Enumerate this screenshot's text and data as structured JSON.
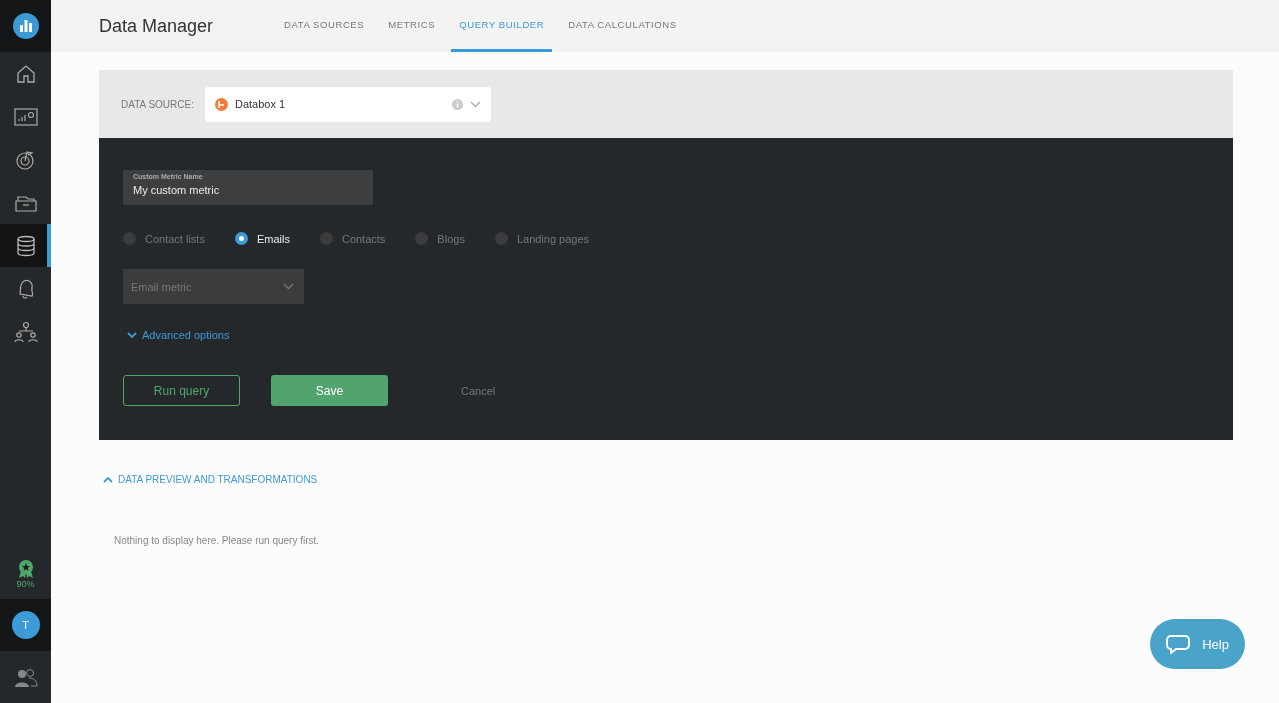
{
  "sidebar": {
    "items": [
      {
        "kind": "home",
        "selected": false
      },
      {
        "kind": "dashboard",
        "selected": false
      },
      {
        "kind": "goal",
        "selected": false
      },
      {
        "kind": "folder",
        "selected": false
      },
      {
        "kind": "database",
        "selected": true
      },
      {
        "kind": "bell",
        "selected": false
      },
      {
        "kind": "team",
        "selected": false
      }
    ],
    "badge": "90%",
    "avatar": "T"
  },
  "header": {
    "title": "Data Manager",
    "tabs": [
      {
        "label": "DATA SOURCES",
        "selected": false
      },
      {
        "label": "METRICS",
        "selected": false
      },
      {
        "label": "QUERY BUILDER",
        "selected": true
      },
      {
        "label": "DATA CALCULATIONS",
        "selected": false
      }
    ]
  },
  "data_source": {
    "label": "DATA SOURCE:",
    "value": "Databox 1"
  },
  "query": {
    "name_field": {
      "label": "Custom Metric Name",
      "value": "My custom metric"
    },
    "options": [
      {
        "label": "Contact lists",
        "selected": false
      },
      {
        "label": "Emails",
        "selected": true
      },
      {
        "label": "Contacts",
        "selected": false
      },
      {
        "label": "Blogs",
        "selected": false
      },
      {
        "label": "Landing pages",
        "selected": false
      }
    ],
    "metric_select": {
      "placeholder": "Email metric"
    },
    "advanced": {
      "label": "Advanced options",
      "expanded": false
    },
    "buttons": {
      "run": "Run query",
      "save": "Save",
      "cancel": "Cancel"
    }
  },
  "preview": {
    "title": "DATA PREVIEW AND TRANSFORMATIONS",
    "expanded": true,
    "empty": "Nothing to display here. Please run query first."
  },
  "help": {
    "label": "Help"
  }
}
